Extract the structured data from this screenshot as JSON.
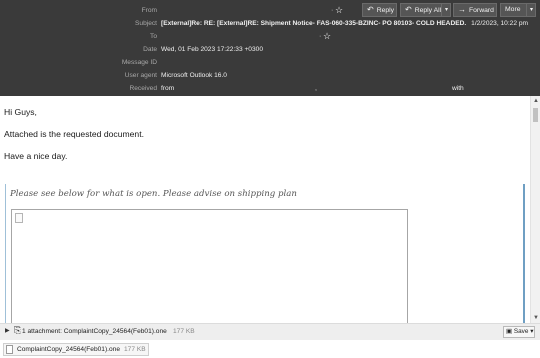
{
  "header": {
    "labels": {
      "from": "From",
      "subject": "Subject",
      "to": "To",
      "date": "Date",
      "message_id": "Message ID",
      "user_agent": "User agent",
      "received": "Received"
    },
    "subject": "[External]Re: RE: [External]RE: Shipment Notice- FAS-060-335-BZINC- PO 80103- COLD HEADED.",
    "sent_datetime": "1/2/2023, 10:22 pm",
    "date": "Wed, 01 Feb 2023 17:22:33 +0300",
    "user_agent": "Microsoft Outlook 16.0",
    "received_from": "from",
    "received_with": "with"
  },
  "toolbar": {
    "reply": "Reply",
    "reply_all": "Reply All",
    "forward": "Forward",
    "more": "More"
  },
  "body": {
    "greeting": "Hi Guys,",
    "line1": "Attached is the requested document.",
    "line2": "Have a nice day.",
    "quote": "Please see below for what is open. Please advise on shipping plan"
  },
  "attachments": {
    "summary": "1 attachment: ComplaintCopy_24564(Feb01).one",
    "summary_size": "177 KB",
    "save_label": "Save",
    "items": [
      {
        "name": "ComplaintCopy_24564(Feb01).one",
        "size": "177 KB"
      }
    ]
  },
  "colors": {
    "header_bg": "#3a3a3a",
    "quote_border": "#6f9fc3"
  }
}
